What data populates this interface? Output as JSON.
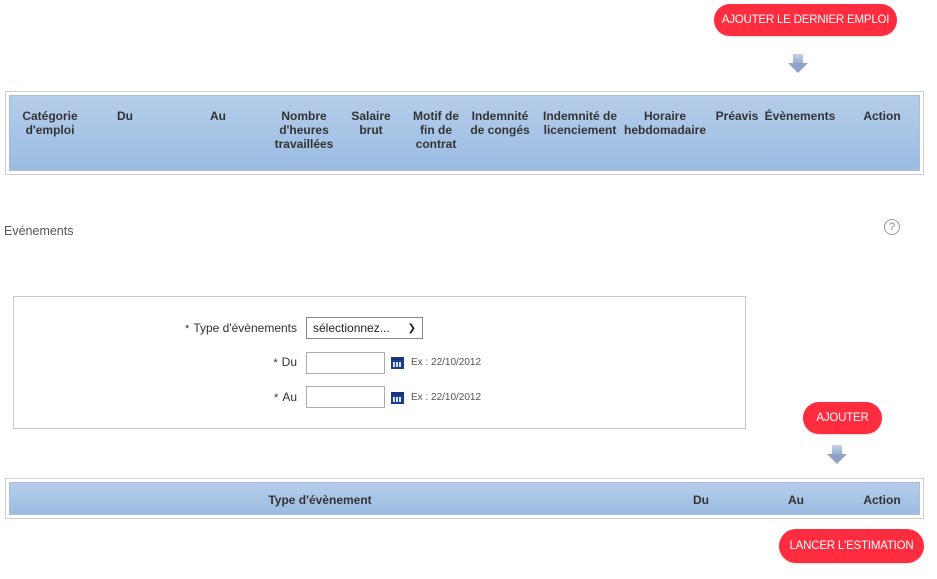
{
  "buttons": {
    "add_last_job": "AJOUTER LE DERNIER EMPLOI",
    "add": "AJOUTER",
    "launch_estimation": "LANCER L'ESTIMATION"
  },
  "jobs_table": {
    "headers": [
      "Catégorie d'emploi",
      "Du",
      "Au",
      "Nombre d'heures travaillées",
      "Salaire brut",
      "Motif de fin de contrat",
      "Indemnité de congés",
      "Indemnité de licenciement",
      "Horaire hebdomadaire",
      "Préavis",
      "Évènements",
      "Action"
    ]
  },
  "events_section": {
    "title": "Evénements",
    "help_icon": "question-circle-icon"
  },
  "form": {
    "type_label": "Type d'évènements",
    "type_selected": "sélectionnez...",
    "du_label": "Du",
    "au_label": "Au",
    "required_mark": "*",
    "du_value": "",
    "au_value": "",
    "date_hint": "Ex : 22/10/2012"
  },
  "events_table": {
    "headers": [
      "Type d'évènement",
      "Du",
      "Au",
      "Action"
    ]
  },
  "colors": {
    "button_red": "#fe2c3f",
    "header_blue_top": "#b5cdea",
    "header_blue_bottom": "#9bbce2"
  }
}
